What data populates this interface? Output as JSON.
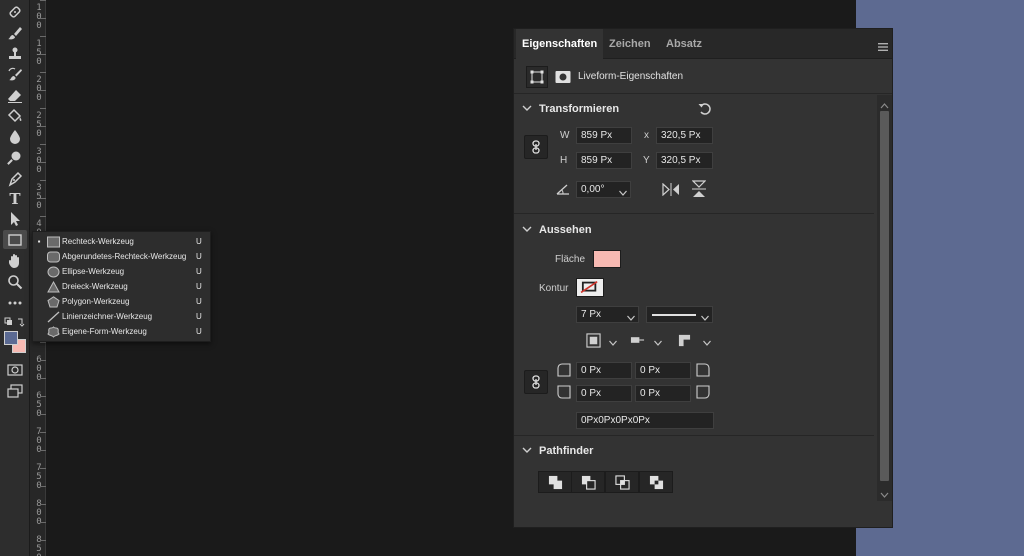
{
  "toolbar": {
    "tools": [
      {
        "name": "healing-brush-icon"
      },
      {
        "name": "brush-icon"
      },
      {
        "name": "stamp-icon"
      },
      {
        "name": "history-brush-icon"
      },
      {
        "name": "eraser-icon"
      },
      {
        "name": "paint-bucket-icon"
      },
      {
        "name": "blur-drop-icon"
      },
      {
        "name": "dodge-icon"
      },
      {
        "name": "pen-icon"
      },
      {
        "name": "type-icon",
        "glyph": "T"
      },
      {
        "name": "path-selection-icon"
      },
      {
        "name": "rectangle-tool-icon"
      },
      {
        "name": "hand-icon"
      },
      {
        "name": "zoom-icon"
      },
      {
        "name": "more-tools-icon"
      }
    ],
    "foreground_color": "#5b6a93",
    "background_color": "#f7b9b2"
  },
  "ruler": {
    "labels": [
      "1",
      "0",
      "0",
      "1",
      "5",
      "0",
      "2",
      "0",
      "0",
      "2",
      "5",
      "0",
      "3",
      "0",
      "0",
      "3",
      "5",
      "0",
      "4",
      "0",
      "0",
      "6",
      "0",
      "0",
      "6",
      "5",
      "0",
      "7",
      "0",
      "0",
      "7",
      "5",
      "0",
      "8",
      "0",
      "0",
      "8",
      "5",
      "0"
    ]
  },
  "flyout": {
    "items": [
      {
        "label": "Rechteck-Werkzeug",
        "key": "U",
        "checked": "▪",
        "icon": "rectangle-icon"
      },
      {
        "label": "Abgerundetes-Rechteck-Werkzeug",
        "key": "U",
        "checked": "",
        "icon": "rounded-rectangle-icon"
      },
      {
        "label": "Ellipse-Werkzeug",
        "key": "U",
        "checked": "",
        "icon": "ellipse-icon"
      },
      {
        "label": "Dreieck-Werkzeug",
        "key": "U",
        "checked": "",
        "icon": "triangle-icon"
      },
      {
        "label": "Polygon-Werkzeug",
        "key": "U",
        "checked": "",
        "icon": "polygon-icon"
      },
      {
        "label": "Linienzeichner-Werkzeug",
        "key": "U",
        "checked": "",
        "icon": "line-icon"
      },
      {
        "label": "Eigene-Form-Werkzeug",
        "key": "U",
        "checked": "",
        "icon": "custom-shape-icon"
      }
    ]
  },
  "panel": {
    "tabs": [
      {
        "label": "Eigenschaften",
        "active": true
      },
      {
        "label": "Zeichen",
        "active": false
      },
      {
        "label": "Absatz",
        "active": false
      }
    ],
    "header_title": "Liveform-Eigenschaften",
    "transform": {
      "title": "Transformieren",
      "w_label": "W",
      "w_value": "859 Px",
      "h_label": "H",
      "h_value": "859 Px",
      "x_label": "x",
      "x_value": "320,5 Px",
      "y_label": "Y",
      "y_value": "320,5 Px",
      "angle_value": "0,00°"
    },
    "appearance": {
      "title": "Aussehen",
      "fill_label": "Fläche",
      "fill_color": "#f7b9b2",
      "stroke_label": "Kontur",
      "stroke_width": "7 Px",
      "corner_tl": "0 Px",
      "corner_tr": "0 Px",
      "corner_bl": "0 Px",
      "corner_br": "0 Px",
      "corner_combined": "0Px0Px0Px0Px"
    },
    "pathfinder": {
      "title": "Pathfinder",
      "buttons": [
        "unite-shapes-icon",
        "subtract-front-icon",
        "intersect-shapes-icon",
        "exclude-overlap-icon"
      ]
    }
  },
  "colors": {
    "desk": "#5d6a91",
    "panel": "#333333",
    "canvas": "#1a1a1a"
  }
}
